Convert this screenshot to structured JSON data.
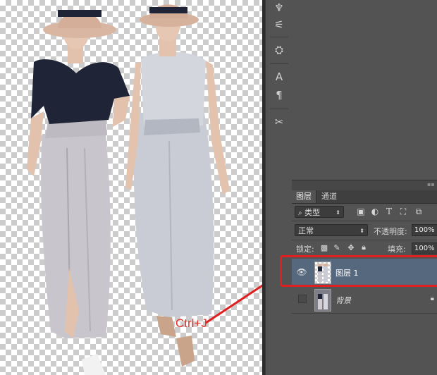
{
  "layers_panel": {
    "tabs": [
      "图层",
      "通道"
    ],
    "filter": {
      "kind_label": "类型",
      "icons": [
        "image-filter-icon",
        "adjustment-filter-icon",
        "text-filter-icon",
        "shape-filter-icon",
        "smart-object-filter-icon"
      ]
    },
    "blend_mode": "正常",
    "opacity_label": "不透明度:",
    "opacity_value": "100%",
    "lock_label": "锁定:",
    "fill_label": "填充:",
    "fill_value": "100%",
    "layers": [
      {
        "name": "图层 1",
        "visible": true,
        "selected": true,
        "locked": false
      },
      {
        "name": "背景",
        "visible": false,
        "selected": false,
        "locked": true
      }
    ]
  },
  "annotation": {
    "text": "Ctrl+J",
    "color": "#e8322a"
  },
  "colors": {
    "panel_bg": "#535353",
    "selected_layer": "#56687d",
    "highlight": "#e02020"
  }
}
